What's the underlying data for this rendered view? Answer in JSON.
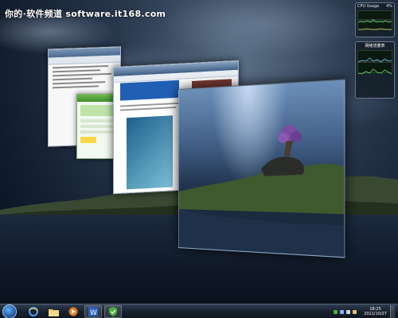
{
  "watermark": "你的·软件频道 software.it168.com",
  "gadgets": {
    "cpu": {
      "title": "CPU Usage",
      "value": "4%"
    },
    "network": {
      "title": "网络流量表"
    }
  },
  "taskbar": {
    "items": [
      {
        "name": "ie-icon",
        "active": false
      },
      {
        "name": "folder-icon",
        "active": false
      },
      {
        "name": "media-player-icon",
        "active": false
      },
      {
        "name": "word-icon",
        "active": true
      },
      {
        "name": "security-app-icon",
        "active": true
      }
    ],
    "clock": {
      "time": "18:25",
      "date": "2011/10/27"
    }
  },
  "colors": {
    "accent": "#1f5fb4",
    "security_green": "#4caf3a",
    "taskbar": "#18222f"
  }
}
